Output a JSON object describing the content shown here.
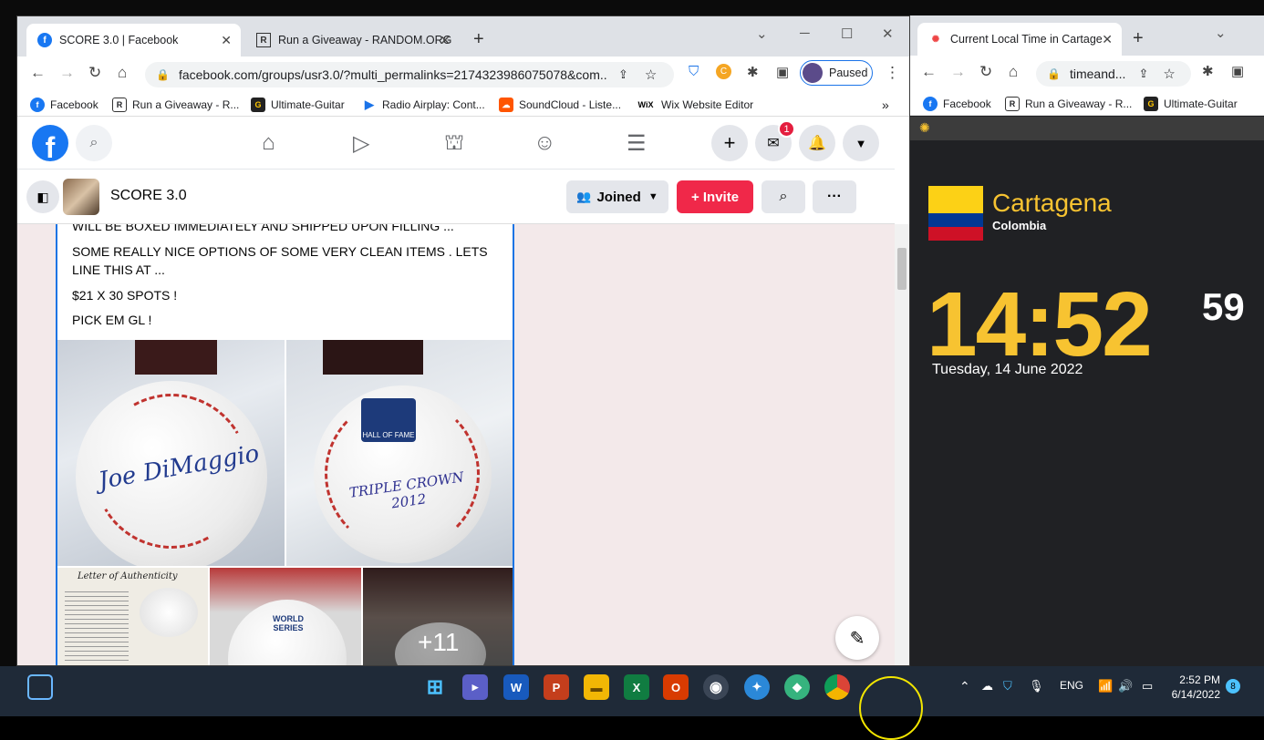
{
  "left_window": {
    "tabs": [
      {
        "title": "SCORE 3.0 | Facebook"
      },
      {
        "title": "Run a Giveaway - RANDOM.ORG"
      }
    ],
    "url": "facebook.com/groups/usr3.0/?multi_permalinks=2174323986075078&com...",
    "profile_status": "Paused",
    "bookmarks": [
      "Facebook",
      "Run a Giveaway - R...",
      "Ultimate-Guitar",
      "Radio Airplay: Cont...",
      "SoundCloud - Liste...",
      "Wix Website Editor"
    ],
    "bookmark_logo_text": "WiX",
    "bookmarks_more": "»",
    "messenger_badge": "1",
    "group_name": "SCORE 3.0",
    "joined_label": "Joined",
    "invite_label": "+ Invite",
    "more_label": "···",
    "post_lines": [
      "WILL BE BOXED IMMEDIATELY AND SHIPPED UPON FILLING ...",
      "SOME REALLY NICE OPTIONS OF SOME VERY CLEAN ITEMS . LETS LINE THIS AT ...",
      "$21 X 30 SPOTS !",
      "PICK EM GL !"
    ],
    "photos": {
      "signature_1": "Joe DiMaggio",
      "signature_2": "TRIPLE CROWN 2012",
      "hof_text": "HALL OF FAME",
      "letter_title": "Letter of Authenticity",
      "world_series": "WORLD SERIES",
      "more_count": "+11"
    }
  },
  "right_window": {
    "tab_title": "Current Local Time in Cartage",
    "url": "timeand...",
    "bookmarks": [
      "Facebook",
      "Run a Giveaway - R...",
      "Ultimate-Guitar"
    ],
    "city": "Cartagena",
    "country": "Colombia",
    "time": "14:52",
    "seconds": "59",
    "date": "Tuesday, 14 June 2022"
  },
  "taskbar": {
    "language": "ENG",
    "clock_time": "2:52 PM",
    "clock_date": "6/14/2022",
    "notification_count": "8"
  },
  "colors": {
    "facebook_blue": "#1877f2",
    "invite_red": "#f02849",
    "clock_yellow": "#f7c331",
    "taskbar": "#1f2a38"
  }
}
